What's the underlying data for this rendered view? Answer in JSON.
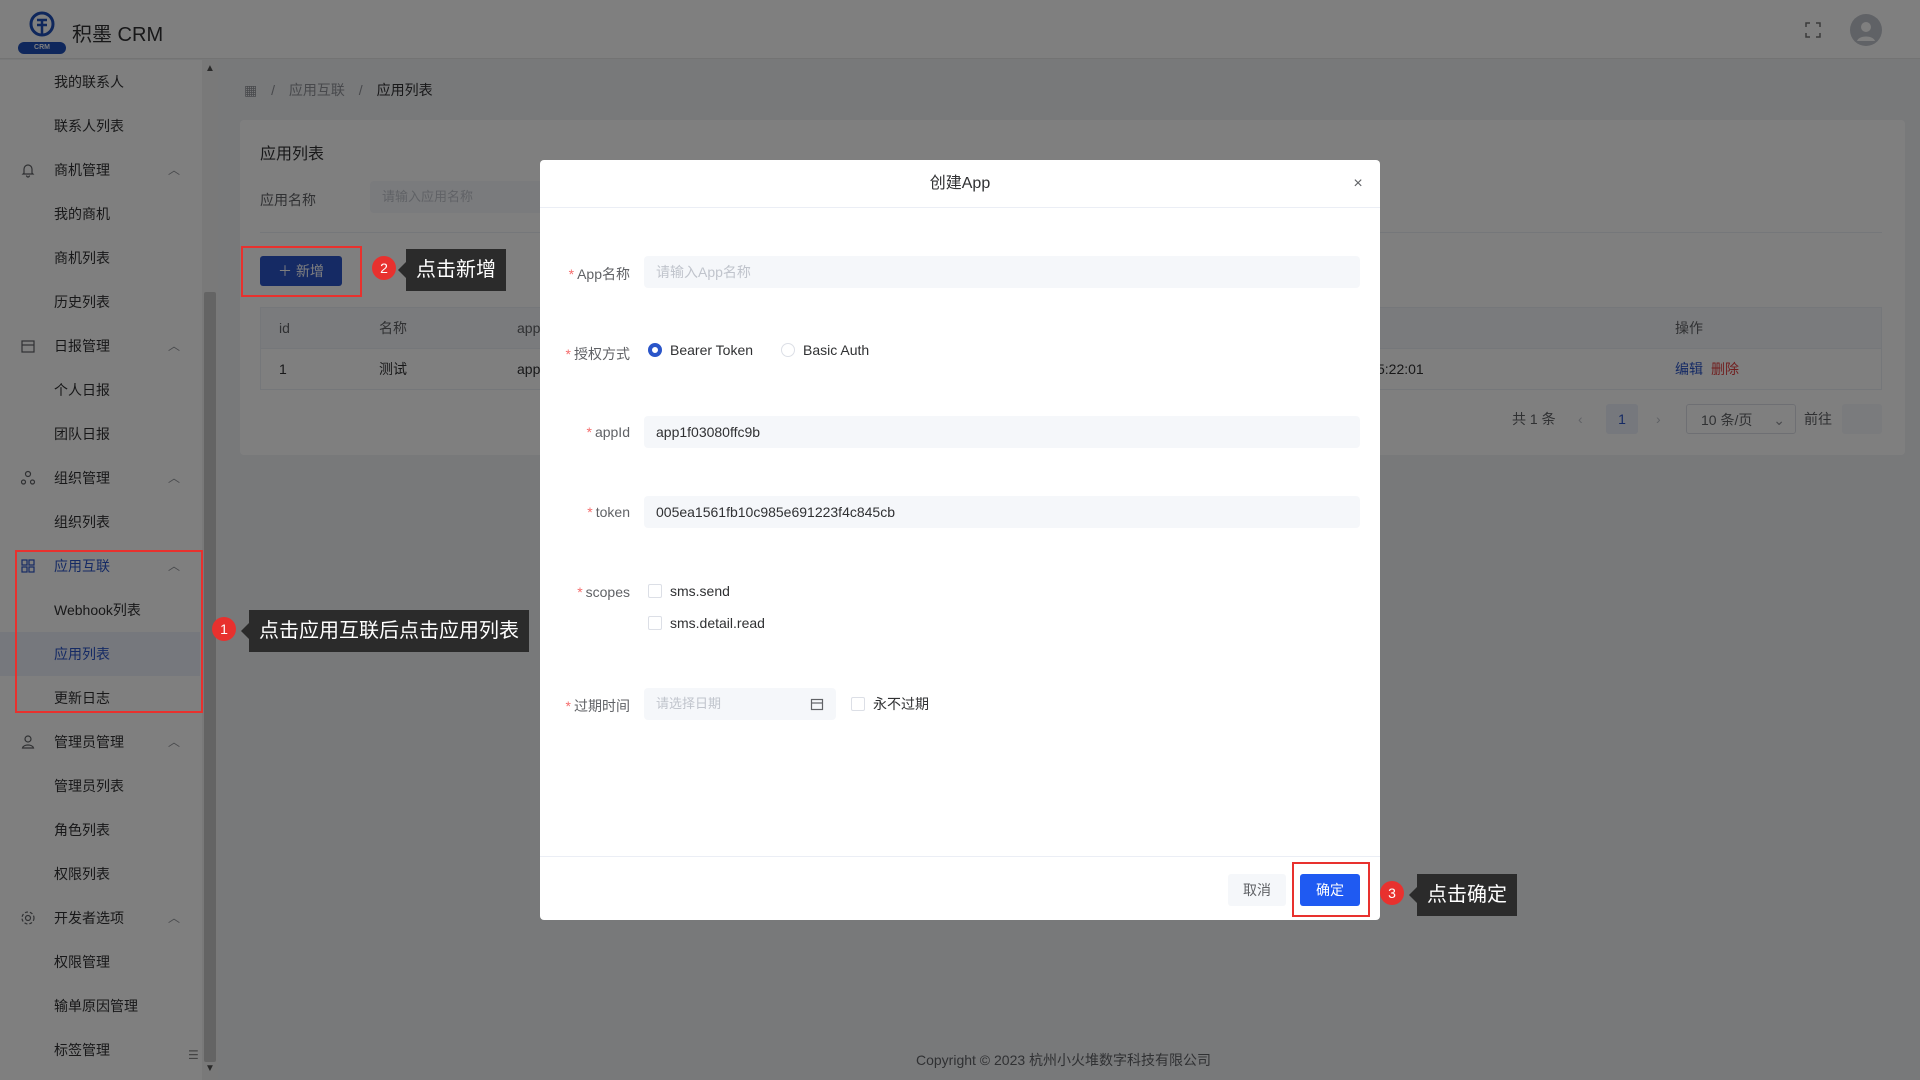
{
  "header": {
    "app_name": "积墨 CRM",
    "logo_text": "CRM"
  },
  "sidebar": {
    "items": [
      {
        "label": "我的联系人",
        "type": "sub"
      },
      {
        "label": "联系人列表",
        "type": "sub"
      },
      {
        "label": "商机管理",
        "type": "group",
        "icon": "bell-icon"
      },
      {
        "label": "我的商机",
        "type": "sub"
      },
      {
        "label": "商机列表",
        "type": "sub"
      },
      {
        "label": "历史列表",
        "type": "sub"
      },
      {
        "label": "日报管理",
        "type": "group",
        "icon": "calendar-icon"
      },
      {
        "label": "个人日报",
        "type": "sub"
      },
      {
        "label": "团队日报",
        "type": "sub"
      },
      {
        "label": "组织管理",
        "type": "group",
        "icon": "org-icon"
      },
      {
        "label": "组织列表",
        "type": "sub"
      },
      {
        "label": "应用互联",
        "type": "group",
        "icon": "grid-icon"
      },
      {
        "label": "Webhook列表",
        "type": "sub"
      },
      {
        "label": "应用列表",
        "type": "sub"
      },
      {
        "label": "更新日志",
        "type": "sub"
      },
      {
        "label": "管理员管理",
        "type": "group",
        "icon": "user-icon"
      },
      {
        "label": "管理员列表",
        "type": "sub"
      },
      {
        "label": "角色列表",
        "type": "sub"
      },
      {
        "label": "权限列表",
        "type": "sub"
      },
      {
        "label": "开发者选项",
        "type": "group",
        "icon": "gear-icon"
      },
      {
        "label": "权限管理",
        "type": "sub"
      },
      {
        "label": "输单原因管理",
        "type": "sub"
      },
      {
        "label": "标签管理",
        "type": "sub"
      }
    ]
  },
  "breadcrumb": {
    "sep": "/",
    "level1": "应用互联",
    "level2": "应用列表"
  },
  "main": {
    "title": "应用列表",
    "filter_label": "应用名称",
    "filter_placeholder": "请输入应用名称",
    "add_button": "新增",
    "table": {
      "headers": {
        "id": "id",
        "name": "名称",
        "app": "app",
        "ops": "操作"
      },
      "row": {
        "id": "1",
        "name": "测试",
        "app": "app",
        "time": "5:22:01",
        "edit": "编辑",
        "delete": "删除"
      }
    },
    "pagination": {
      "total": "共 1 条",
      "prev": "‹",
      "page": "1",
      "next": "›",
      "size": "10 条/页",
      "jump": "前往"
    }
  },
  "dialog": {
    "title": "创建App",
    "close": "×",
    "fields": {
      "app_name_label": "App名称",
      "app_name_placeholder": "请输入App名称",
      "auth_label": "授权方式",
      "auth_opt1": "Bearer Token",
      "auth_opt2": "Basic Auth",
      "auth_selected": "Bearer Token",
      "appid_label": "appId",
      "appid_value": "app1f03080ffc9b",
      "token_label": "token",
      "token_value": "005ea1561fb10c985e691223f4c845cb",
      "scopes_label": "scopes",
      "scope1": "sms.send",
      "scope2": "sms.detail.read",
      "expire_label": "过期时间",
      "expire_placeholder": "请选择日期",
      "never_expire": "永不过期"
    },
    "cancel": "取消",
    "confirm": "确定"
  },
  "annotations": {
    "step1_num": "1",
    "step1_text": "点击应用互联后点击应用列表",
    "step2_num": "2",
    "step2_text": "点击新增",
    "step3_num": "3",
    "step3_text": "点击确定"
  },
  "footer": "Copyright © 2023 杭州小火堆数字科技有限公司",
  "colors": {
    "primary": "#2a55c9",
    "confirm": "#1f5af2",
    "annotation": "#e8312e",
    "danger": "#e23f3f"
  }
}
